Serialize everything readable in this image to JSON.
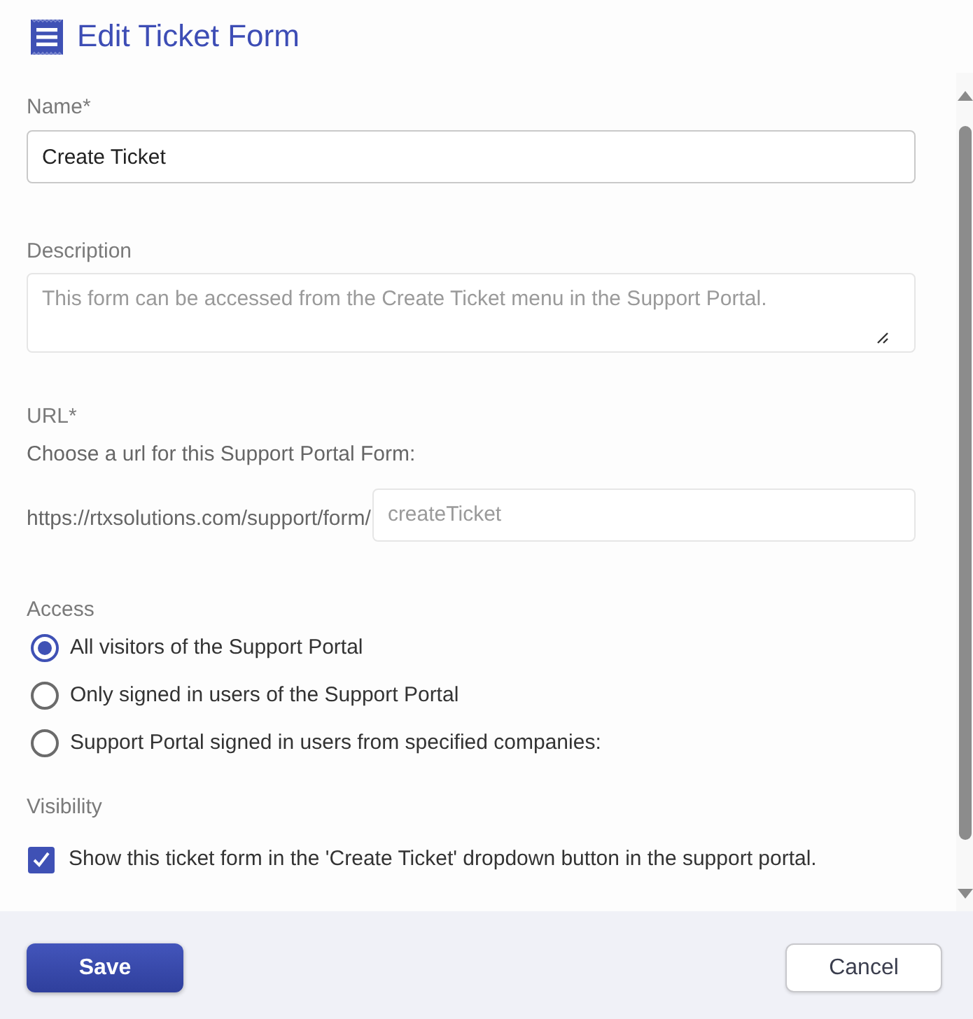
{
  "header": {
    "title": "Edit Ticket Form"
  },
  "fields": [
    {
      "kind": "text",
      "label": "Name*",
      "value": "Create Ticket"
    },
    {
      "kind": "textarea",
      "label": "Description",
      "placeholder": "This form can be accessed from the Create Ticket menu in the Support Portal."
    },
    {
      "kind": "url",
      "label": "URL*",
      "hint": "Choose a url for this Support Portal Form:",
      "prefix": "https://rtxsolutions.com/support/form/",
      "placeholder": "createTicket"
    }
  ],
  "access": {
    "label": "Access",
    "options": [
      {
        "label": "All visitors of the Support Portal",
        "selected": true
      },
      {
        "label": "Only signed in users of the Support Portal",
        "selected": false
      },
      {
        "label": "Support Portal signed in users from specified companies:",
        "selected": false
      }
    ]
  },
  "visibility": {
    "label": "Visibility",
    "checkbox": {
      "label": "Show this ticket form in the 'Create Ticket' dropdown button in the support portal.",
      "checked": true
    }
  },
  "footer": {
    "buttons": [
      {
        "label": "Save",
        "kind": "primary"
      },
      {
        "label": "Cancel",
        "kind": "secondary"
      }
    ]
  }
}
